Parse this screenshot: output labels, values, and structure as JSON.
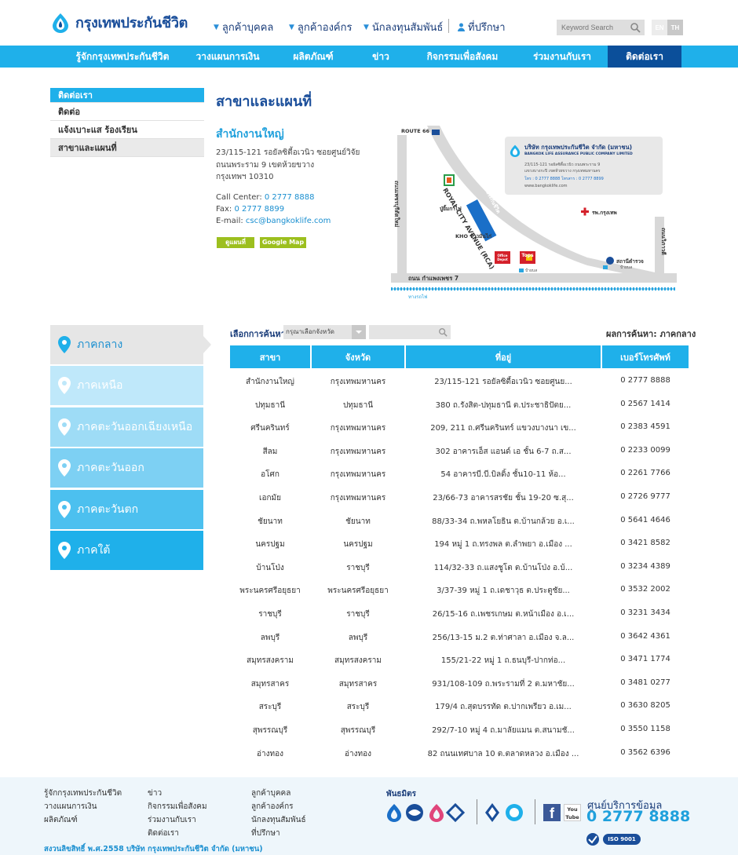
{
  "header": {
    "logo_text": "กรุงเทพประกันชีวิต",
    "top_links": [
      {
        "label": "ลูกค้าบุคคล"
      },
      {
        "label": "ลูกค้าองค์กร"
      },
      {
        "label": "นักลงทุนสัมพันธ์"
      },
      {
        "label": "ที่ปรึกษา"
      }
    ],
    "search_placeholder": "Keyword Search",
    "lang": {
      "en": "EN",
      "th": "TH"
    }
  },
  "main_nav": [
    {
      "label": "รู้จักกรุงเทพประกันชีวิต"
    },
    {
      "label": "วางแผนการเงิน"
    },
    {
      "label": "ผลิตภัณฑ์"
    },
    {
      "label": "ข่าว"
    },
    {
      "label": "กิจกรรมเพื่อสังคม"
    },
    {
      "label": "ร่วมงานกับเรา"
    },
    {
      "label": "ติดต่อเรา"
    }
  ],
  "left_menu": {
    "title": "ติดต่อเรา",
    "items": [
      {
        "label": "ติดต่อ"
      },
      {
        "label": "แจ้งเบาะแส ร้องเรียน"
      },
      {
        "label": "สาขาและแผนที่"
      }
    ]
  },
  "page_title": "สาขาและแผนที่",
  "hq": {
    "title": "สำนักงานใหญ่",
    "address1": "23/115-121 รอยัลซิตี้อเวนิว ซอยศูนย์วิจัย",
    "address2": "ถนนพระราม 9 เขตห้วยขวาง",
    "address3": "กรุงเทพฯ 10310",
    "call_label": "Call Center:",
    "call_value": "0 2777 8888",
    "fax_label": "Fax:",
    "fax_value": "0 2777 8899",
    "email_label": "E-mail:",
    "email_value": "csc@bangkoklife.com",
    "btn_map": "ดูแผนที่",
    "btn_google": "Google Map"
  },
  "map": {
    "route66": "ROUTE 66",
    "road_rca": "ROYAL CITY AVENUE (RCA)",
    "building": "กรุงเทพประกันชีวิต",
    "company_th": "บริษัท กรุงเทพประกันชีวิต จำกัด (มหาชน)",
    "company_en": "BANGKOK LIFE ASSURANCE PUBLIC COMPANY LIMITED",
    "company_addr1": "23/115-121 รอยัลซิตี้อเวนิว ถนนพระราม 9",
    "company_addr2": "แขวงบางกะปิ เขตห้วยขวาง กรุงเทพมหานคร",
    "company_tel": "โทร : 0 2777 8888 โทรสาร : 0 2777 8899",
    "company_web": "www.bangkoklife.com",
    "hospital": "รพ.กรุงเทพ",
    "road_left": "ถนนเพชรบุรีตัดใหม่",
    "road_right": "ถนนวิภาวดี",
    "road_bottom": "ถนน กำแพงเพชร 7",
    "railway": "ทางรถไฟ",
    "grill": "ปู่ยิ้มกาไฟ",
    "kho": "KHO ข้าวมันไก่",
    "police": "สถานีตำรวจ",
    "office_depot": "Office Depot",
    "tops": "Tops",
    "busstop1": "ป้ายบส",
    "busstop2": "ป้ายบส"
  },
  "regions": [
    {
      "label": "ภาคกลาง"
    },
    {
      "label": "ภาคเหนือ"
    },
    {
      "label": "ภาคตะวันออกเฉียงเหนือ"
    },
    {
      "label": "ภาคตะวันออก"
    },
    {
      "label": "ภาคตะวันตก"
    },
    {
      "label": "ภาคใต้"
    }
  ],
  "filter": {
    "label": "เลือกการค้นหา",
    "province_placeholder": "กรุณาเลือกจังหวัด",
    "result": "ผลการค้นหา: ภาคกลาง"
  },
  "table": {
    "headers": [
      "สาขา",
      "จังหวัด",
      "ที่อยู่",
      "เบอร์โทรศัพท์"
    ],
    "rows": [
      [
        "สำนักงานใหญ่",
        "กรุงเทพมหานคร",
        "23/115-121 รอยัลซิตี้อเวนิว ซอยศูนย...",
        "0 2777 8888"
      ],
      [
        "ปทุมธานี",
        "ปทุมธานี",
        "380 ถ.รังสิต-ปทุมธานี ต.ประชาธิปัตย...",
        "0 2567 1414"
      ],
      [
        "ศรีนครินทร์",
        "กรุงเทพมหานคร",
        "209, 211 ถ.ศรีนครินทร์ แขวงบางนา เข...",
        "0 2383 4591"
      ],
      [
        "สีลม",
        "กรุงเทพมหานคร",
        "302 อาคารเอ็ส แอนด์ เอ ชั้น 6-7 ถ.ส...",
        "0 2233 0099"
      ],
      [
        "อโศก",
        "กรุงเทพมหานคร",
        "54 อาคารบี.บี.บิลดิ้ง ชั้น10-11 ห้อ...",
        "0 2261 7766"
      ],
      [
        "เอกมัย",
        "กรุงเทพมหานคร",
        "23/66-73 อาคารสรชัย ชั้น 19-20 ซ.สุ...",
        "0 2726 9777"
      ],
      [
        "ชัยนาท",
        "ชัยนาท",
        "88/33-34 ถ.พหลโยธิน ต.บ้านกล้วย อ.เ...",
        "0 5641 4646"
      ],
      [
        "นครปฐม",
        "นครปฐม",
        "194 หมู่ 1 ถ.ทรงพล ต.ลำพยา อ.เมือง ...",
        "0 3421 8582"
      ],
      [
        "บ้านโป่ง",
        "ราชบุรี",
        "114/32-33 ถ.แสงชูโต ต.บ้านโป่ง อ.บ้...",
        "0 3234 4389"
      ],
      [
        "พระนครศรีอยุธยา",
        "พระนครศรีอยุธยา",
        "3/37-39 หมู่ 1 ถ.เดชาวุธ ต.ประตูชัย...",
        "0 3532 2002"
      ],
      [
        "ราชบุรี",
        "ราชบุรี",
        "26/15-16 ถ.เพชรเกษม ต.หน้าเมือง อ.เ...",
        "0 3231 3434"
      ],
      [
        "ลพบุรี",
        "ลพบุรี",
        "256/13-15 ม.2 ต.ท่าศาลา อ.เมือง จ.ล...",
        "0 3642 4361"
      ],
      [
        "สมุทรสงคราม",
        "สมุทรสงคราม",
        "155/21-22 หมู่ 1 ถ.ธนบุรี-ปากท่อ...",
        "0 3471 1774"
      ],
      [
        "สมุทรสาคร",
        "สมุทรสาคร",
        "931/108-109 ถ.พระรามที่ 2 ต.มหาชัย...",
        "0 3481 0277"
      ],
      [
        "สระบุรี",
        "สระบุรี",
        "179/4 ถ.สุดบรรทัด ต.ปากเพรียว อ.เม...",
        "0 3630 8205"
      ],
      [
        "สุพรรณบุรี",
        "สุพรรณบุรี",
        "292/7-10 หมู่ 4 ถ.มาลัยแมน ต.สนามชั...",
        "0 3550 1158"
      ],
      [
        "อ่างทอง",
        "อ่างทอง",
        "82 ถนนเทศบาล 10 ต.ตลาดหลวง อ.เมือง ...",
        "0 3562 6396"
      ]
    ]
  },
  "footer": {
    "col1": [
      "รู้จักกรุงเทพประกันชีวิต",
      "วางแผนการเงิน",
      "ผลิตภัณฑ์"
    ],
    "col2": [
      "ข่าว",
      "กิจกรรมเพื่อสังคม",
      "ร่วมงานกับเรา",
      "ติดต่อเรา"
    ],
    "col3": [
      "ลูกค้าบุคคล",
      "ลูกค้าองค์กร",
      "นักลงทุนสัมพันธ์",
      "ที่ปรึกษา"
    ],
    "partners_label": "พันธมิตร",
    "youtube_label": "You Tube",
    "service_label": "ศูนย์บริการข้อมูล",
    "service_phone": "0 2777 8888",
    "iso": "ISO 9001",
    "copyright": "สงวนลิขสิทธิ์ พ.ศ.2558 บริษัท กรุงเทพประกันชีวิต จำกัด (มหาชน)"
  },
  "colors": {
    "primary": "#1fb0ea",
    "navy": "#0b4f9a",
    "green": "#9cbf1e"
  }
}
